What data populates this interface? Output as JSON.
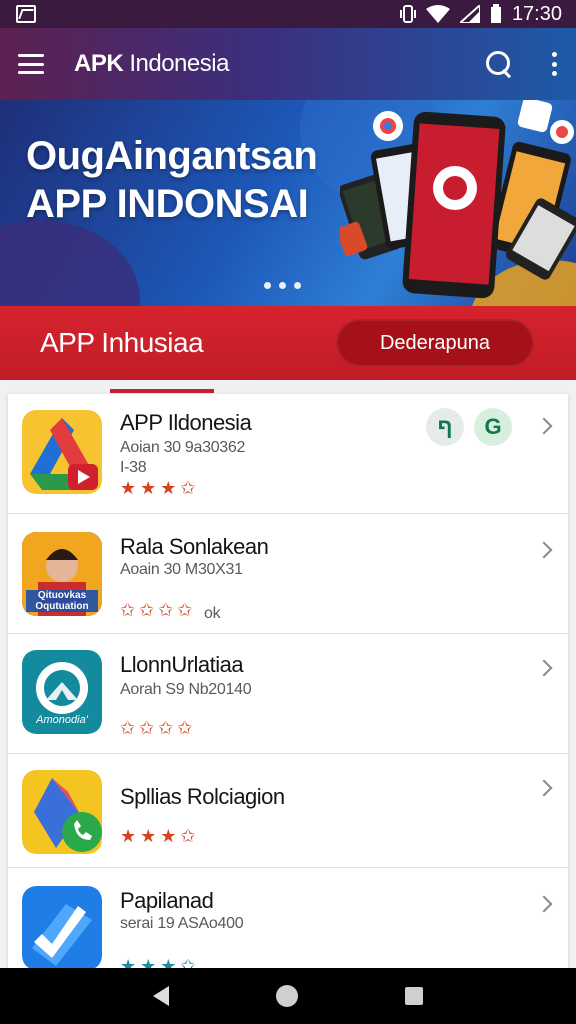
{
  "status_bar": {
    "time": "17:30"
  },
  "app_bar": {
    "title_bold": "APK",
    "title_rest": " Indonesia"
  },
  "banner": {
    "line1": "OugAingantsan",
    "line2": "APP INDONSAI"
  },
  "sub_bar": {
    "title": "APP Inhusiaa",
    "button_label": "Dederapuna"
  },
  "apps": [
    {
      "name": "APP Ildonesia",
      "sub1": "Aoian 30 9a30362",
      "sub2": "I-38",
      "stars": "★★★✩",
      "rating_text": ""
    },
    {
      "name": "Rala Sonlakean",
      "sub1": "Aoain 30 M30X31",
      "sub2": "",
      "stars": "✩✩✩✩",
      "rating_text": "ok"
    },
    {
      "name": "LlonnUrlatiaa",
      "sub1": "Aorah S9 Nb20140",
      "sub2": "",
      "stars": "✩✩✩✩",
      "rating_text": ""
    },
    {
      "name": "Spllias Rolciagion",
      "sub1": "",
      "sub2": "",
      "stars": "★★★✩",
      "rating_text": ""
    },
    {
      "name": "Papilanad",
      "sub1": "serai 19 ASAo400",
      "sub2": "",
      "stars": "★★★✩",
      "rating_text": ""
    }
  ],
  "icon_texts": {
    "app2": "Qituovkas Oqutuation",
    "app3": "Amonodia'"
  }
}
